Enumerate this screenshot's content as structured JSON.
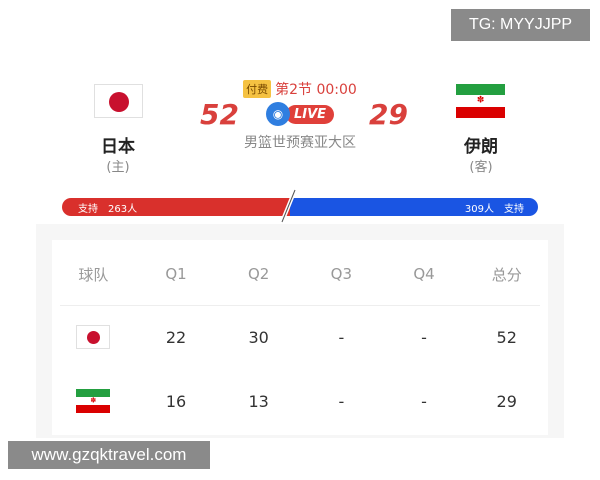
{
  "watermark_text": "TG: MYYJJPP",
  "url_text": "www.gzqktravel.com",
  "match": {
    "paid_label": "付费",
    "period": "第2节 00:00",
    "live_label": "LIVE",
    "league": "男篮世预赛亚大区"
  },
  "home": {
    "name": "日本",
    "role": "(主)",
    "score": "52",
    "flag": "japan-flag"
  },
  "away": {
    "name": "伊朗",
    "role": "(客)",
    "score": "29",
    "flag": "iran-flag"
  },
  "support": {
    "left_label": "支持",
    "left_count": "263人",
    "right_count": "309人",
    "right_label": "支持",
    "left_color": "#d9302c",
    "right_color": "#1a55e3"
  },
  "table": {
    "headers": [
      "球队",
      "Q1",
      "Q2",
      "Q3",
      "Q4",
      "总分"
    ],
    "rows": [
      {
        "team_flag": "japan-flag",
        "cells": [
          "22",
          "30",
          "-",
          "-",
          "52"
        ]
      },
      {
        "team_flag": "iran-flag",
        "cells": [
          "16",
          "13",
          "-",
          "-",
          "29"
        ]
      }
    ]
  },
  "colors": {
    "score_red": "#d9403c",
    "live_blue": "#2f7ee0"
  }
}
